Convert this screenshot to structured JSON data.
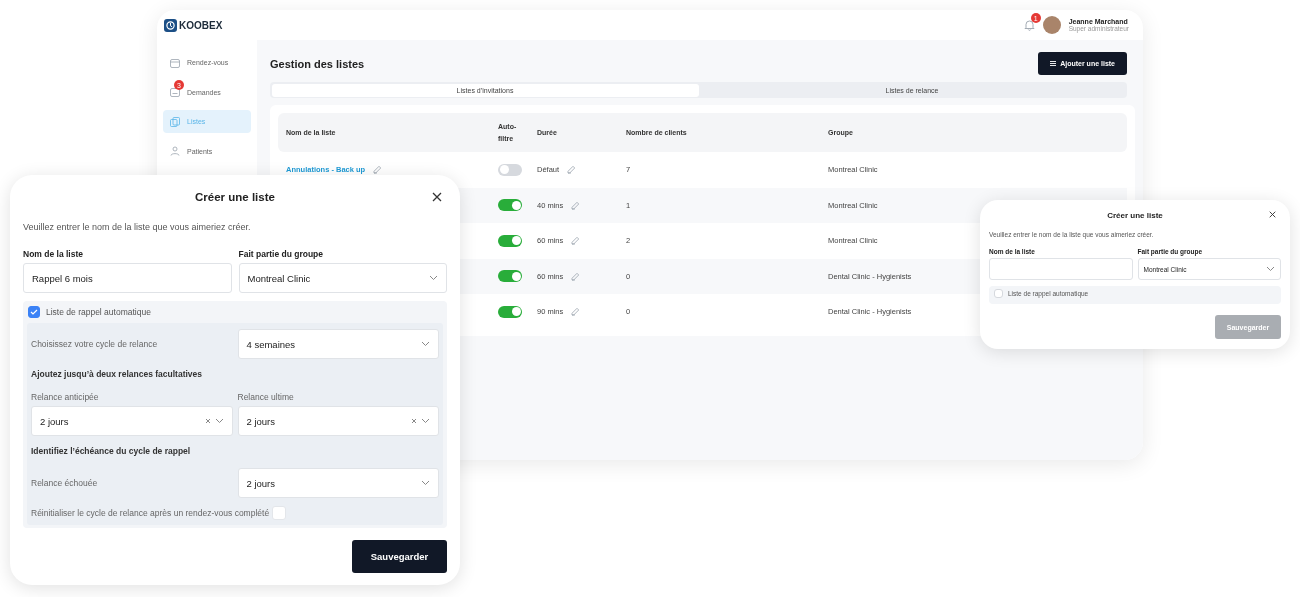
{
  "app": {
    "logo": "KOOBEX",
    "notification_count": "1",
    "user": {
      "name": "Jeanne Marchand",
      "role": "Super administrateur"
    },
    "sidebar": {
      "items": [
        {
          "label": "Rendez-vous",
          "selected": false
        },
        {
          "label": "Demandes",
          "badge": "3",
          "selected": false
        },
        {
          "label": "Listes",
          "selected": true
        },
        {
          "label": "Patients",
          "selected": false
        }
      ]
    },
    "page_title": "Gestion des listes",
    "add_button": "Ajouter une liste",
    "tabs": [
      {
        "label": "Listes d’invitations",
        "selected": true
      },
      {
        "label": "Listes de relance",
        "selected": false
      }
    ],
    "table": {
      "columns": [
        "Nom de la liste",
        "Auto-filtre",
        "Durée",
        "Nombre de clients",
        "Groupe"
      ],
      "rows": [
        {
          "name": "Annulations - Back up",
          "auto_filter": false,
          "duration": "Défaut",
          "clients": "7",
          "group": "Montreal Clinic"
        },
        {
          "auto_filter": true,
          "duration": "40 mins",
          "clients": "1",
          "group": "Montreal Clinic"
        },
        {
          "auto_filter": true,
          "duration": "60 mins",
          "clients": "2",
          "group": "Montreal Clinic"
        },
        {
          "auto_filter": true,
          "duration": "60 mins",
          "clients": "0",
          "group": "Dental Clinic - Hygienists"
        },
        {
          "auto_filter": true,
          "duration": "90 mins",
          "clients": "0",
          "group": "Dental Clinic - Hygienists"
        }
      ]
    }
  },
  "dialogs": [
    {
      "title": "Créer une liste",
      "description": "Veuillez entrer le nom de la liste que vous aimeriez créer.",
      "name_field": {
        "label": "Nom de la liste",
        "value": "Rappel 6 mois"
      },
      "group_field": {
        "label": "Fait partie du groupe",
        "value": "Montreal Clinic"
      },
      "auto_reminder": {
        "label": "Liste de rappel automatique",
        "checked": true
      },
      "reminder": {
        "cycle": {
          "label": "Choisissez votre cycle de relance",
          "value": "4 semaines",
          "clearable": false
        },
        "optional_heading": "Ajoutez jusqu’à deux relances facultatives",
        "early": {
          "label": "Relance anticipée",
          "value": "2 jours",
          "clearable": true
        },
        "last": {
          "label": "Relance ultime",
          "value": "2 jours",
          "clearable": true
        },
        "deadline_heading": "Identifiez l’échéance du cycle de rappel",
        "failed": {
          "label": "Relance échouée",
          "value": "2 jours",
          "clearable": false
        },
        "reset": {
          "label": "Réinitialiser le cycle de relance après un rendez-vous complété",
          "checked": false
        }
      },
      "save_button": {
        "label": "Sauvegarder",
        "disabled": false
      }
    },
    {
      "title": "Créer une liste",
      "description": "Veuillez entrer le nom de la liste que vous aimeriez créer.",
      "name_field": {
        "label": "Nom de la liste"
      },
      "group_field": {
        "label": "Fait partie du groupe",
        "value": "Montreal Clinic"
      },
      "auto_reminder": {
        "label": "Liste de rappel automatique",
        "checked": false
      },
      "save_button": {
        "label": "Sauvegarder",
        "disabled": true
      }
    }
  ]
}
